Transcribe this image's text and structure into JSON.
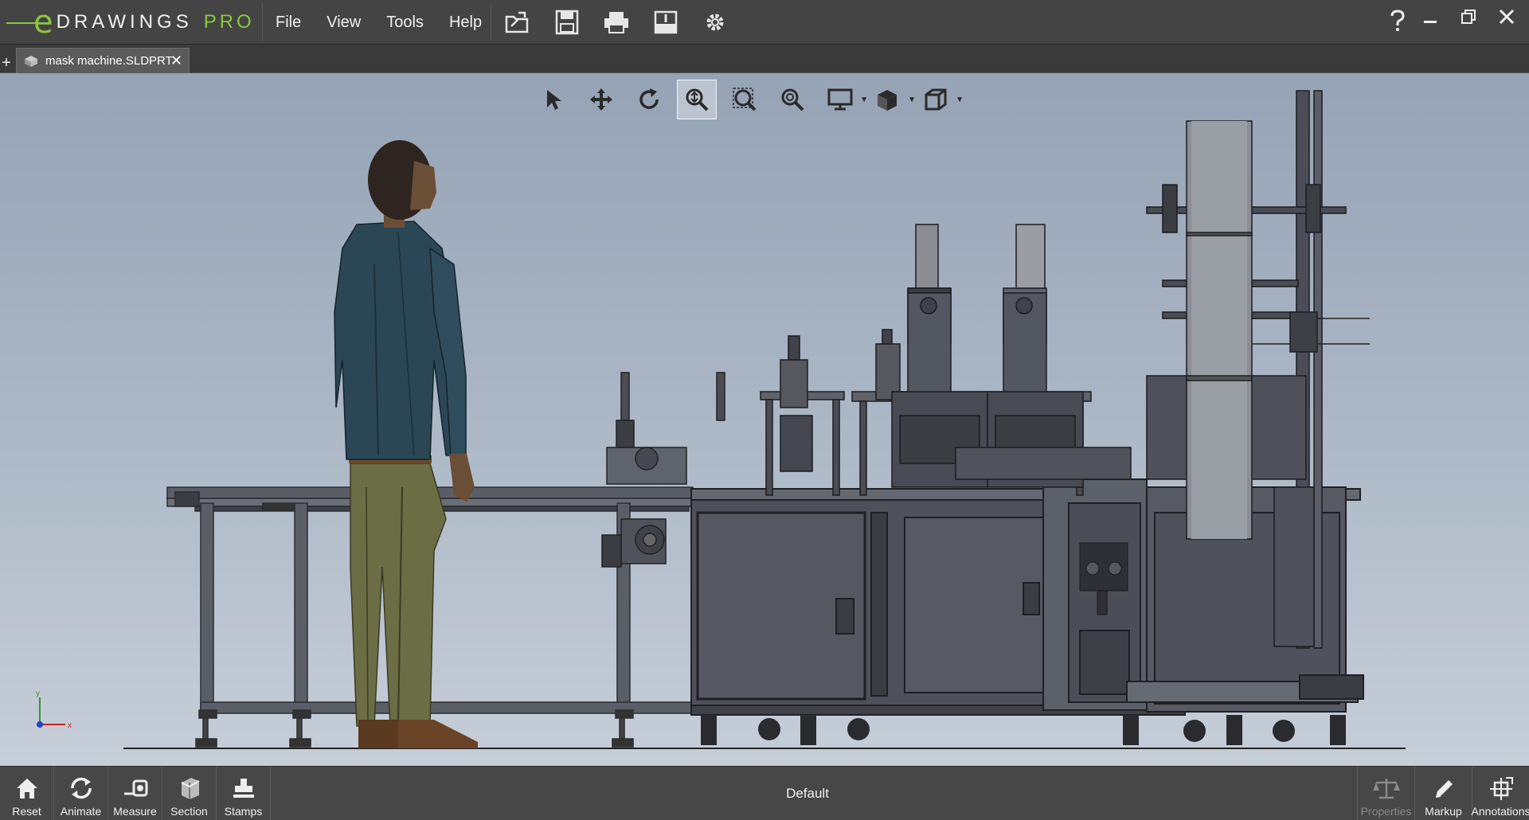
{
  "app": {
    "logo_letter": "e",
    "name": "DRAWINGS",
    "edition": "PRO",
    "accent_color": "#8cc63f"
  },
  "menu": {
    "items": [
      "File",
      "View",
      "Tools",
      "Help"
    ]
  },
  "quick_tools": [
    "open-icon",
    "save-icon",
    "print-icon",
    "publish-icon",
    "settings-icon"
  ],
  "window_controls": [
    "help-icon",
    "minimize-icon",
    "restore-icon",
    "close-icon"
  ],
  "tabs": {
    "active_document": "mask machine.SLDPRT"
  },
  "view_toolbar": {
    "tools": [
      "select-icon",
      "pan-icon",
      "rotate-icon",
      "zoom-to-fit-icon",
      "zoom-to-area-icon",
      "zoom-icon",
      "display-style-icon",
      "view-settings-icon",
      "standard-views-icon"
    ],
    "active": "zoom-to-fit-icon"
  },
  "axis": {
    "x_label": "x",
    "y_label": "y"
  },
  "bottom_toolbar": {
    "left": [
      {
        "label": "Reset",
        "icon": "home-icon"
      },
      {
        "label": "Animate",
        "icon": "animate-icon"
      },
      {
        "label": "Measure",
        "icon": "measure-icon"
      },
      {
        "label": "Section",
        "icon": "section-icon"
      },
      {
        "label": "Stamps",
        "icon": "stamps-icon"
      }
    ],
    "configuration": "Default",
    "right": [
      {
        "label": "Properties",
        "icon": "properties-icon",
        "enabled": false
      },
      {
        "label": "Markup",
        "icon": "markup-icon",
        "enabled": true
      },
      {
        "label": "Annotations",
        "icon": "annotations-icon",
        "enabled": true
      }
    ]
  }
}
